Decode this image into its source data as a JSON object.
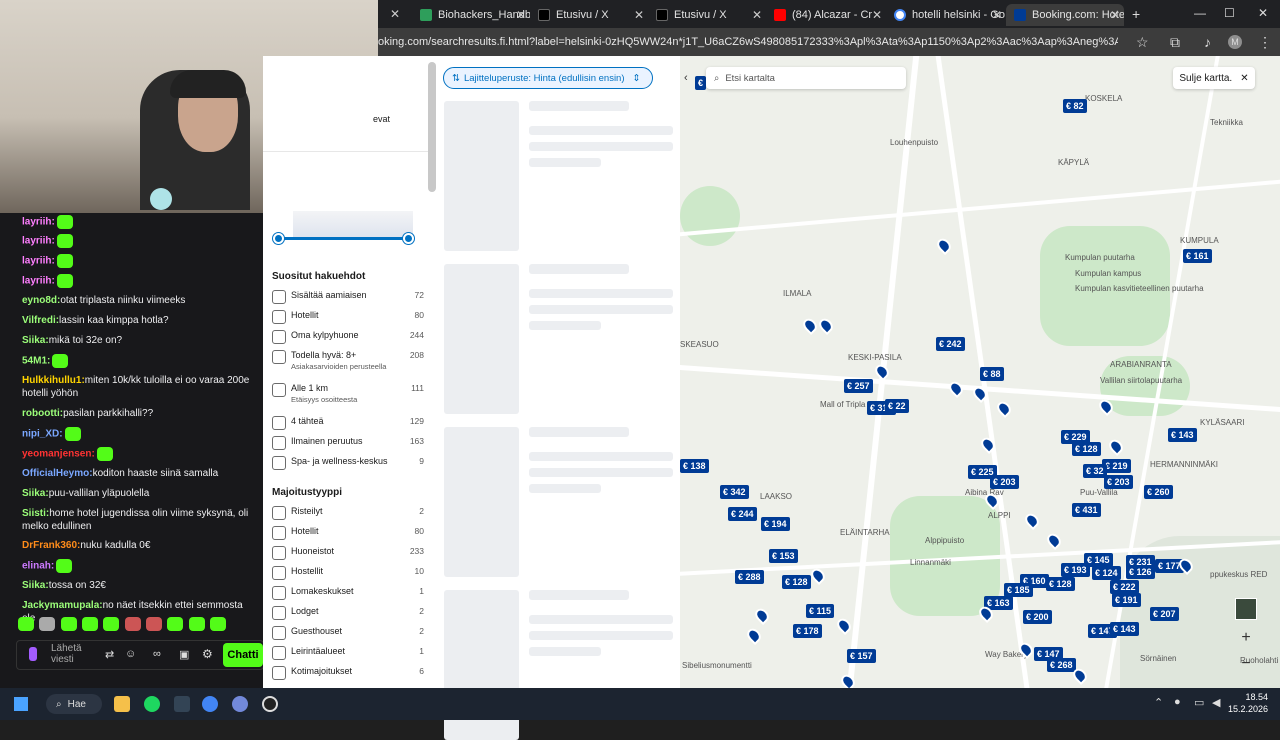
{
  "tabs": [
    {
      "label": "Biohackers_Handbo",
      "color": "#2e9e5b"
    },
    {
      "label": "Etusivu / X",
      "color": "#000000"
    },
    {
      "label": "Etusivu / X",
      "color": "#000000"
    },
    {
      "label": "(84) Alcazar - Cr",
      "color": "#ff0000"
    },
    {
      "label": "hotelli helsinki - Go",
      "color": "#4285f4"
    },
    {
      "label": "Booking.com: Hotel",
      "color": "#003b95"
    }
  ],
  "url": "oking.com/searchresults.fi.html?label=helsinki-0zHQ5WW24n*j1T_U6aCZ6wS498085172333%3Apl%3Ata%3Ap1150%3Ap2%3Aac%3Aap%3Aneg%3Afi%3Atiaud-2382347442848%3...",
  "chat": {
    "messages": [
      {
        "user": "layriih:",
        "user_color": "#ff7fff",
        "text": ""
      },
      {
        "user": "layriih:",
        "user_color": "#ff7fff",
        "text": ""
      },
      {
        "user": "layriih:",
        "user_color": "#ff7fff",
        "text": ""
      },
      {
        "user": "layriih:",
        "user_color": "#ff7fff",
        "text": ""
      },
      {
        "user": "eyno8d:",
        "user_color": "#9cff7a",
        "text": "otat triplasta niinku viimeeks"
      },
      {
        "user": "Vilfredi:",
        "user_color": "#9cff7a",
        "text": "lassin kaa kimppa hotla?"
      },
      {
        "user": "Siika:",
        "user_color": "#9cff7a",
        "text": "mikä toi 32e on?"
      },
      {
        "user": "54M1:",
        "user_color": "#9cff7a",
        "text": ""
      },
      {
        "user": "Hulkkihullu1:",
        "user_color": "#ffd400",
        "text": "miten 10k/kk tuloilla ei oo varaa 200e hotelli yöhön"
      },
      {
        "user": "robootti:",
        "user_color": "#9cff7a",
        "text": "pasilan parkkihalli??"
      },
      {
        "user": "nipi_XD:",
        "user_color": "#7aa7ff",
        "text": ""
      },
      {
        "user": "yeomanjensen:",
        "user_color": "#ff3333",
        "text": ""
      },
      {
        "user": "OfficialHeymo:",
        "user_color": "#7aa7ff",
        "text": "koditon haaste siinä samalla"
      },
      {
        "user": "Siika:",
        "user_color": "#9cff7a",
        "text": "puu-vallilan yläpuolella"
      },
      {
        "user": "Siisti:",
        "user_color": "#9cff7a",
        "text": "home hotel jugendissa olin viime syksynä, oli melko edullinen"
      },
      {
        "user": "DrFrank360:",
        "user_color": "#ff8c1a",
        "text": "nuku kadulla 0€"
      },
      {
        "user": "elinah:",
        "user_color": "#cc7aff",
        "text": ""
      },
      {
        "user": "Siika:",
        "user_color": "#9cff7a",
        "text": "tossa on 32€"
      },
      {
        "user": "Jackymamupala:",
        "user_color": "#9cff7a",
        "text": "no näet itsekkin ettei semmosta ole"
      }
    ],
    "input_placeholder": "Lähetä viesti",
    "send_label": "Chatti"
  },
  "filters": {
    "partial_label": "evat",
    "popular_heading": "Suositut hakuehdot",
    "popular": [
      {
        "label": "Sisältää aamiaisen",
        "count": "72",
        "sub": ""
      },
      {
        "label": "Hotellit",
        "count": "80",
        "sub": ""
      },
      {
        "label": "Oma kylpyhuone",
        "count": "244",
        "sub": ""
      },
      {
        "label": "Todella hyvä: 8+",
        "count": "208",
        "sub": "Asiakasarvioiden perusteella"
      },
      {
        "label": "Alle 1 km",
        "count": "111",
        "sub": "Etäisyys osoitteesta"
      },
      {
        "label": "4 tähteä",
        "count": "129",
        "sub": ""
      },
      {
        "label": "Ilmainen peruutus",
        "count": "163",
        "sub": ""
      },
      {
        "label": "Spa- ja wellness-keskus",
        "count": "9",
        "sub": ""
      }
    ],
    "type_heading": "Majoitustyyppi",
    "types": [
      {
        "label": "Risteilyt",
        "count": "2"
      },
      {
        "label": "Hotellit",
        "count": "80"
      },
      {
        "label": "Huoneistot",
        "count": "233"
      },
      {
        "label": "Hostellit",
        "count": "10"
      },
      {
        "label": "Lomakeskukset",
        "count": "1"
      },
      {
        "label": "Lodget",
        "count": "2"
      },
      {
        "label": "Guesthouset",
        "count": "2"
      },
      {
        "label": "Leirintäalueet",
        "count": "1"
      },
      {
        "label": "Kotimajoitukset",
        "count": "6"
      }
    ]
  },
  "results": {
    "sort_label": "Lajitteluperuste: Hinta (edullisin ensin)"
  },
  "map": {
    "search_placeholder": "Etsi kartalta",
    "close_label": "Sulje kartta.",
    "places": [
      "KOSKELA",
      "Louhenpuisto",
      "KÄPYLÄ",
      "KUMPULA",
      "Kumpulan puutarha",
      "Kumpulan kampus",
      "Kumpulan kasvitieteellinen puutarha",
      "ILMALA",
      "KESKI-PASILA",
      "Mall of Tripla",
      "ARABIANRANTA",
      "Vallilan siirtolapuutarha",
      "HERMANNINMÄKI",
      "KYLÄSAARI",
      "SKEASUO",
      "LAAKSO",
      "ELÄINTARHA",
      "Alppipuisto",
      "Linnanmäki",
      "Puu-Vallila",
      "ALPPI",
      "Aibina Rav",
      "Sibeliusmonumentti",
      "Sörnäinen",
      "Way Bakery",
      "Ruoholahti",
      "Tekniikka",
      "ppukeskus RED"
    ],
    "prices": [
      "€ 82",
      "€ 161",
      "€ 242",
      "€ 88",
      "€ 257",
      "€ 318",
      "€ 22",
      "€ 229",
      "€ 128",
      "€ 143",
      "€ 219",
      "€ 32",
      "€ 203",
      "€ 260",
      "€ 225",
      "€ 203",
      "€ 431",
      "€ 342",
      "€ 244",
      "€ 194",
      "€ 153",
      "€ 288",
      "€ 128",
      "€ 115",
      "€ 178",
      "€ 157",
      "€ 193",
      "€ 145",
      "€ 231",
      "€ 126",
      "€ 177",
      "€ 124",
      "€ 160",
      "€ 128",
      "€ 185",
      "€ 222",
      "€ 191",
      "€ 163",
      "€ 200",
      "€ 207",
      "€ 147",
      "€ 143",
      "€ 147",
      "€ 268",
      "€ 138",
      "€"
    ]
  },
  "taskbar": {
    "search_label": "Hae",
    "time": "18.54",
    "date": "15.2.2026"
  }
}
